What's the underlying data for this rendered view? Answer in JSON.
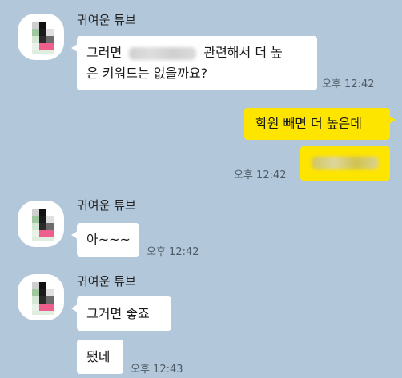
{
  "colors": {
    "background": "#b2c7da",
    "received_bubble": "#ffffff",
    "sent_bubble": "#fee500"
  },
  "messages": [
    {
      "sender": "귀여운 튜브",
      "line1_before": "그러면",
      "line1_after": "관련해서 더 높",
      "line2": "은 키워드는 없을까요?",
      "time": "오후 12:42"
    },
    {
      "text": "학원 빼면 더 높은데"
    },
    {
      "time": "오후 12:42"
    },
    {
      "sender": "귀여운 튜브",
      "text": "아~~~",
      "time": "오후 12:42"
    },
    {
      "sender": "귀여운 튜브",
      "text": "그거면 좋죠"
    },
    {
      "text": "됐네",
      "time": "오후 12:43"
    }
  ]
}
